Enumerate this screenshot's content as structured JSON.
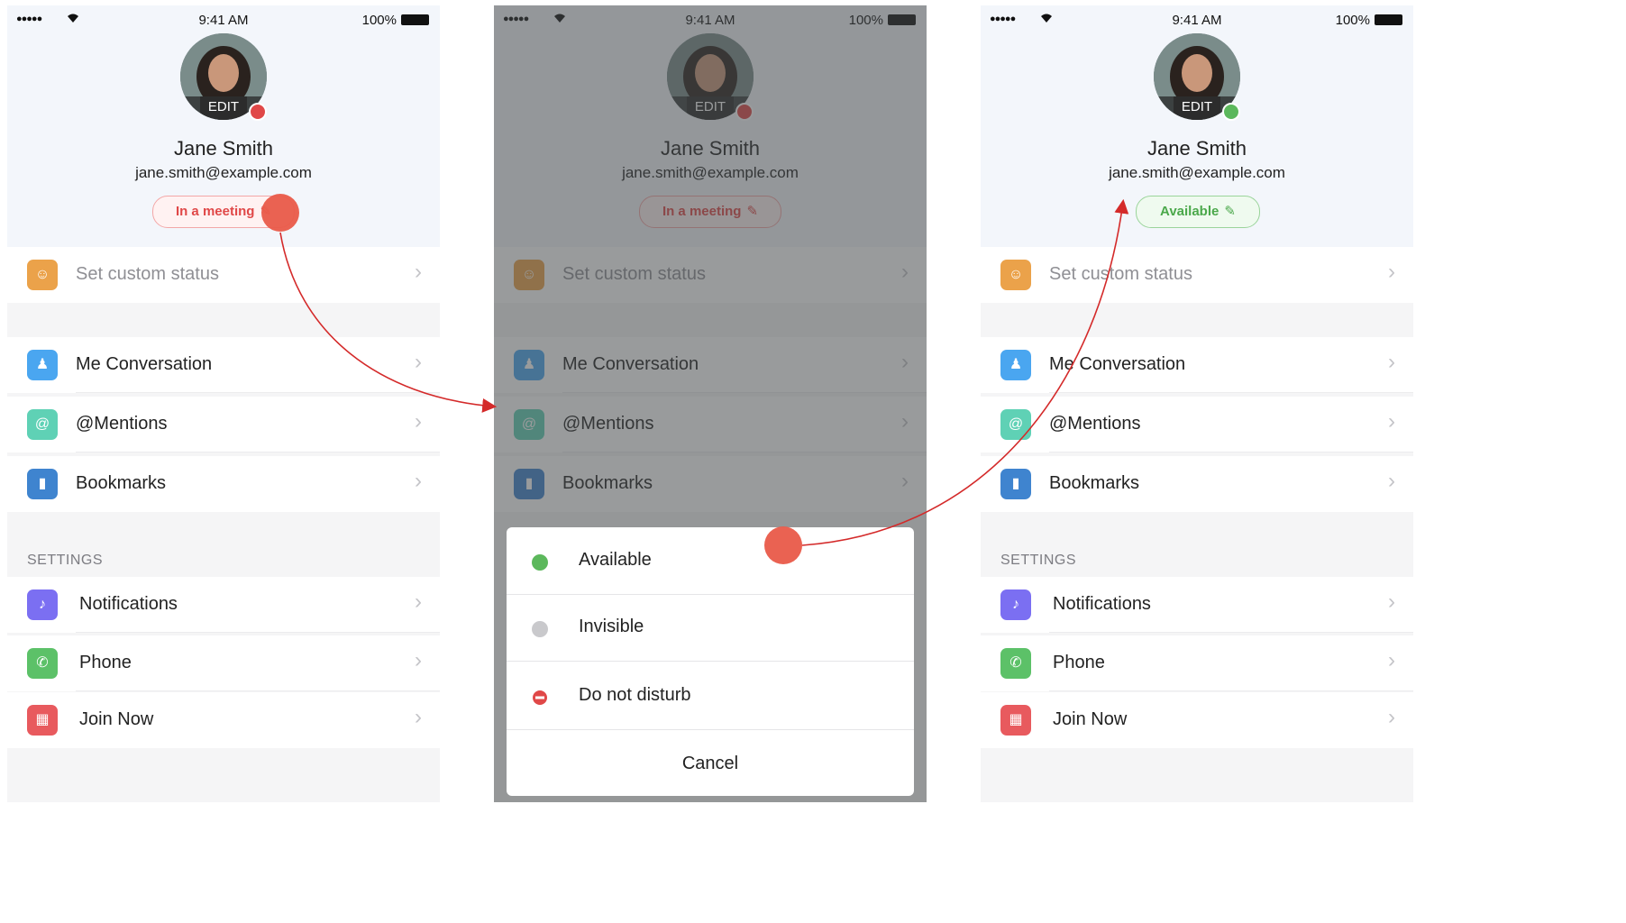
{
  "colors": {
    "header_bg": "#f3f6fb",
    "busy_red": "#e04848",
    "available_green": "#5cb85c",
    "invisible_grey": "#c9c9cc",
    "tap_marker": "#e95a49",
    "arrow": "#d42a2a"
  },
  "statusbar": {
    "time": "9:41 AM",
    "battery": "100%",
    "signal": "●●●●●"
  },
  "profile": {
    "name": "Jane Smith",
    "email": "jane.smith@example.com",
    "avatar_edit": "EDIT"
  },
  "status_meeting": "In a meeting",
  "status_available": "Available",
  "pencil_icon": "✎",
  "menu": {
    "custom_status": "Set custom status",
    "me_conversation": "Me Conversation",
    "mentions": "@Mentions",
    "bookmarks": "Bookmarks",
    "settings_header": "SETTINGS",
    "notifications": "Notifications",
    "phone": "Phone",
    "join_now": "Join Now"
  },
  "icons": {
    "custom_status": "smiley-icon",
    "me_conversation": "person-icon",
    "mentions": "at-icon",
    "bookmarks": "bookmark-icon",
    "notifications": "bell-icon",
    "phone": "phone-icon",
    "join_now": "calendar-icon",
    "chevron": "chevron-right-icon"
  },
  "icon_glyphs": {
    "custom_status": "☺",
    "me_conversation": "♟",
    "mentions": "@",
    "bookmarks": "▮",
    "notifications": "♪",
    "phone": "✆",
    "join_now": "▦",
    "chevron": "›"
  },
  "sheet": {
    "available": "Available",
    "invisible": "Invisible",
    "do_not_disturb": "Do not disturb",
    "cancel": "Cancel"
  }
}
